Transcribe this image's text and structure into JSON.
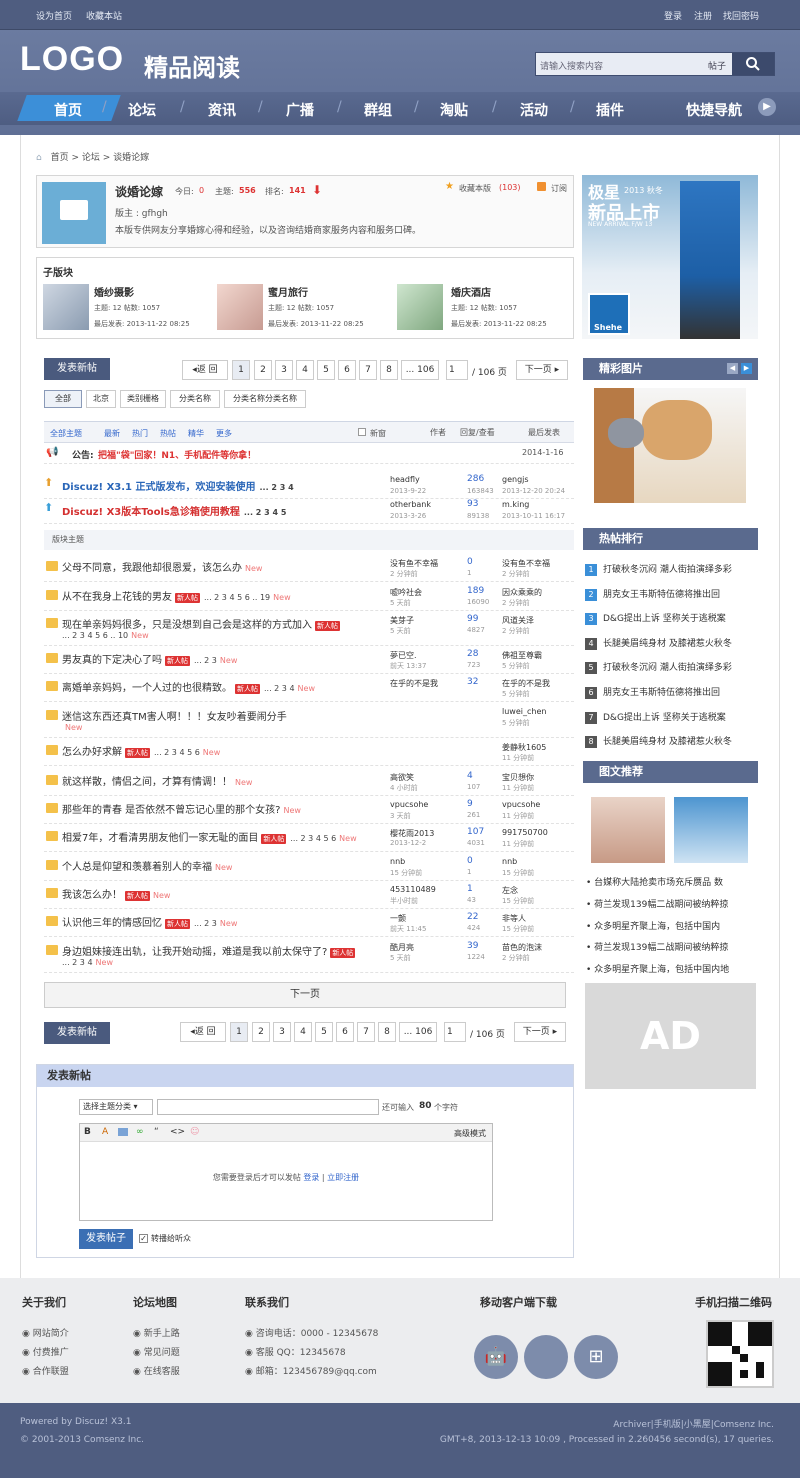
{
  "topbar": {
    "set_home": "设为首页",
    "favorite": "收藏本站",
    "login": "登录",
    "register": "注册",
    "forgot": "找回密码"
  },
  "header": {
    "logo": "LOGO",
    "site_name": "精品阅读",
    "search_placeholder": "请输入搜索内容",
    "search_option": "帖子"
  },
  "nav": {
    "items": [
      "首页",
      "论坛",
      "资讯",
      "广播",
      "群组",
      "淘贴",
      "活动",
      "插件"
    ],
    "quick": "快捷导航"
  },
  "breadcrumb": [
    "首页",
    "论坛",
    "谈婚论嫁"
  ],
  "forum": {
    "name": "谈婚论嫁",
    "today_label": "今日:",
    "today": "0",
    "threads_label": "主题:",
    "threads": "556",
    "rank_label": "排名:",
    "rank": "141",
    "moderator": "版主 : gfhgh",
    "desc": "本版专供网友分享婚嫁心得和经验，以及咨询结婚商家服务内容和服务口碑。",
    "fav_label": "收藏本版",
    "fav_count": "(103)",
    "subscribe": "订阅"
  },
  "subboards": {
    "title": "子版块",
    "items": [
      {
        "name": "婚纱摄影",
        "stats": "主题: 12  帖数: 1057",
        "last": "最后发表: 2013-11-22 08:25"
      },
      {
        "name": "蜜月旅行",
        "stats": "主题: 12  帖数: 1057",
        "last": "最后发表: 2013-11-22 08:25"
      },
      {
        "name": "婚庆酒店",
        "stats": "主题: 12  帖数: 1057",
        "last": "最后发表: 2013-11-22 08:25"
      }
    ]
  },
  "post_button": "发表新帖",
  "pager": {
    "back": "◂返 回",
    "pages": [
      "1",
      "2",
      "3",
      "4",
      "5",
      "6",
      "7",
      "8"
    ],
    "more": "... 106",
    "current": "1",
    "total": "/ 106 页",
    "next": "下一页 ▸"
  },
  "filters": [
    "全部",
    "北京",
    "类别栅格",
    "分类名称",
    "分类名称分类名称"
  ],
  "thead": {
    "all": "全部主题",
    "latest": "最新",
    "hot": "热门",
    "hotpost": "热帖",
    "digest": "精华",
    "more": "更多",
    "newwin": "新窗",
    "author": "作者",
    "replies": "回复/查看",
    "last": "最后发表"
  },
  "announce": {
    "label": "公告:",
    "text": "把福\"袋\"回家！N1、手机配件等你拿！",
    "date": "2014-1-16"
  },
  "sticky": [
    {
      "title": "Discuz! X3.1 正式版发布，欢迎安装使用",
      "pages": "... 2 3 4",
      "author": "headfly",
      "date": "2013-9-22",
      "replies": "286",
      "views": "163843",
      "last": "gengjs",
      "last_date": "2013-12-20 20:24",
      "color": "#2a66b8"
    },
    {
      "title": "Discuz! X3版本Tools急诊箱使用教程",
      "pages": "... 2 3 4 5",
      "author": "otherbank",
      "date": "2013-3-26",
      "replies": "93",
      "views": "89138",
      "last": "m.king",
      "last_date": "2013-10-11 16:17",
      "color": "#d43030"
    }
  ],
  "section_label": "版块主题",
  "tag_label": "新人帖",
  "new_label": "New",
  "threads": [
    {
      "title": "父母不同意，我跟他却很恩爱，该怎么办",
      "tag": false,
      "pages": "",
      "author": "没有鱼不幸福",
      "adate": "2 分钟前",
      "r": "0",
      "v": "1",
      "last": "没有鱼不幸福",
      "ldate": "2 分钟前"
    },
    {
      "title": "从不在我身上花钱的男友",
      "tag": true,
      "pages": "... 2 3 4 5 6 .. 19",
      "author": "嘘吟社会",
      "adate": "5 天前",
      "r": "189",
      "v": "16090",
      "last": "因众乘乘的",
      "ldate": "2 分钟前"
    },
    {
      "title": "现在单亲妈妈很多，只是没想到自己会是这样的方式加入",
      "tag": true,
      "pages": "... 2 3 4 5 6 .. 10",
      "author": "美芽子",
      "adate": "5 天前",
      "r": "99",
      "v": "4827",
      "last": "风道关泽",
      "ldate": "2 分钟前"
    },
    {
      "title": "男友真的下定决心了吗",
      "tag": true,
      "pages": "... 2 3",
      "author": "夢已空.",
      "adate": "前天 13:37",
      "r": "28",
      "v": "723",
      "last": "佛祖至尊霸",
      "ldate": "5 分钟前"
    },
    {
      "title": "离婚单亲妈妈，一个人过的也很精致。",
      "tag": true,
      "pages": "... 2 3 4",
      "author": "在乎的不是我",
      "adate": "",
      "r": "32",
      "v": "",
      "last": "在乎的不是我",
      "ldate": "5 分钟前"
    },
    {
      "title": "迷信这东西还真TM害人啊！！！女友吵着要闹分手",
      "tag": false,
      "pages": "",
      "author": "",
      "adate": "",
      "r": "",
      "v": "",
      "last": "luwei_chen",
      "ldate": "5 分钟前"
    },
    {
      "title": "怎么办好求解",
      "tag": true,
      "pages": "... 2 3 4 5 6",
      "author": "",
      "adate": "",
      "r": "",
      "v": "",
      "last": "姜静秋1605",
      "ldate": "11 分钟前"
    },
    {
      "title": "就这样散，情侣之间，才算有情调！！",
      "tag": false,
      "pages": "",
      "author": "高欲笑",
      "adate": "4 小时前",
      "r": "4",
      "v": "107",
      "last": "宝贝想你",
      "ldate": "11 分钟前"
    },
    {
      "title": "那些年的青春 是否依然不曾忘记心里的那个女孩?",
      "tag": false,
      "pages": "",
      "author": "vpucsohe",
      "adate": "3 天前",
      "r": "9",
      "v": "261",
      "last": "vpucsohe",
      "ldate": "11 分钟前"
    },
    {
      "title": "相爱7年，才看清男朋友他们一家无耻的面目",
      "tag": true,
      "pages": "... 2 3 4 5 6",
      "author": "樱花雨2013",
      "adate": "2013-12-2",
      "r": "107",
      "v": "4031",
      "last": "991750700",
      "ldate": "11 分钟前"
    },
    {
      "title": "个人总是仰望和羡慕着别人的幸福",
      "tag": false,
      "pages": "",
      "author": "nnb",
      "adate": "15 分钟前",
      "r": "0",
      "v": "1",
      "last": "nnb",
      "ldate": "15 分钟前"
    },
    {
      "title": "我该怎么办！",
      "tag": true,
      "pages": "",
      "author": "453110489",
      "adate": "半小时前",
      "r": "1",
      "v": "43",
      "last": "左念",
      "ldate": "15 分钟前"
    },
    {
      "title": "认识他三年的情感回忆",
      "tag": true,
      "pages": "... 2 3",
      "author": "一颤",
      "adate": "前天 11:45",
      "r": "22",
      "v": "424",
      "last": "非等人",
      "ldate": "15 分钟前"
    },
    {
      "title": "身边姐妹接连出轨，让我开始动摇，难道是我以前太保守了?",
      "tag": true,
      "pages": "... 2 3 4",
      "author": "酷月亮",
      "adate": "5 天前",
      "r": "39",
      "v": "1224",
      "last": "苗色的泡沫",
      "ldate": "2 分钟前"
    }
  ],
  "next_page": "下一页",
  "post_form": {
    "title": "发表新帖",
    "category": "选择主题分类",
    "remain": "还可输入",
    "remain_count": "80",
    "remain_unit": "个字符",
    "advanced": "高级模式",
    "login_msg": "您需要登录后才可以发帖",
    "login": "登录",
    "register": "立即注册",
    "submit": "发表帖子",
    "broadcast": "转播给听众"
  },
  "sidebar": {
    "banner_line1": "极星",
    "banner_season": "2013 秋冬",
    "banner_line2": "新品上市",
    "banner_sub": "NEW ARRIVAL F/W 13",
    "banner_brand": "Shehe",
    "pics_title": "精彩图片",
    "hot_title": "热帖排行",
    "hot": [
      "打破秋冬沉闷 潮人街拍演绎多彩",
      "朋克女王韦斯特伍德将推出回",
      "D&G提出上诉 坚称关于逃税案",
      "长腿美眉纯身材 及膝裙惹火秋冬",
      "打破秋冬沉闷 潮人街拍演绎多彩",
      "朋克女王韦斯特伍德将推出回",
      "D&G提出上诉 坚称关于逃税案",
      "长腿美眉纯身材 及膝裙惹火秋冬"
    ],
    "hot_colors": [
      "#3a8fd8",
      "#3a8fd8",
      "#3a8fd8",
      "#555",
      "#555",
      "#555",
      "#555",
      "#555"
    ],
    "news_title": "图文推荐",
    "news": [
      "台媒称大陆抢卖市场充斥赝品 数",
      "荷兰发现139幅二战期间被纳粹掠",
      "众多明星齐聚上海，包括中国内",
      "荷兰发现139幅二战期间被纳粹掠",
      "众多明星齐聚上海，包括中国内地"
    ],
    "ad": "AD"
  },
  "footer": {
    "about": {
      "title": "关于我们",
      "links": [
        "网站简介",
        "付费推广",
        "合作联盟"
      ]
    },
    "map": {
      "title": "论坛地图",
      "links": [
        "新手上路",
        "常见问题",
        "在线客服"
      ]
    },
    "contact": {
      "title": "联系我们",
      "links": [
        "咨询电话：0000 - 12345678",
        "客服 QQ：12345678",
        "邮箱：123456789@qq.com"
      ]
    },
    "mobile": "移动客户端下载",
    "qr": "手机扫描二维码",
    "powered": "Powered by Discuz! X3.1",
    "copyright": "© 2001-2013 Comsenz Inc.",
    "links": "Archiver|手机版|小黑屋|Comsenz Inc.",
    "timing": "GMT+8, 2013-12-13 10:09 , Processed in 2.260456 second(s), 17 queries."
  }
}
